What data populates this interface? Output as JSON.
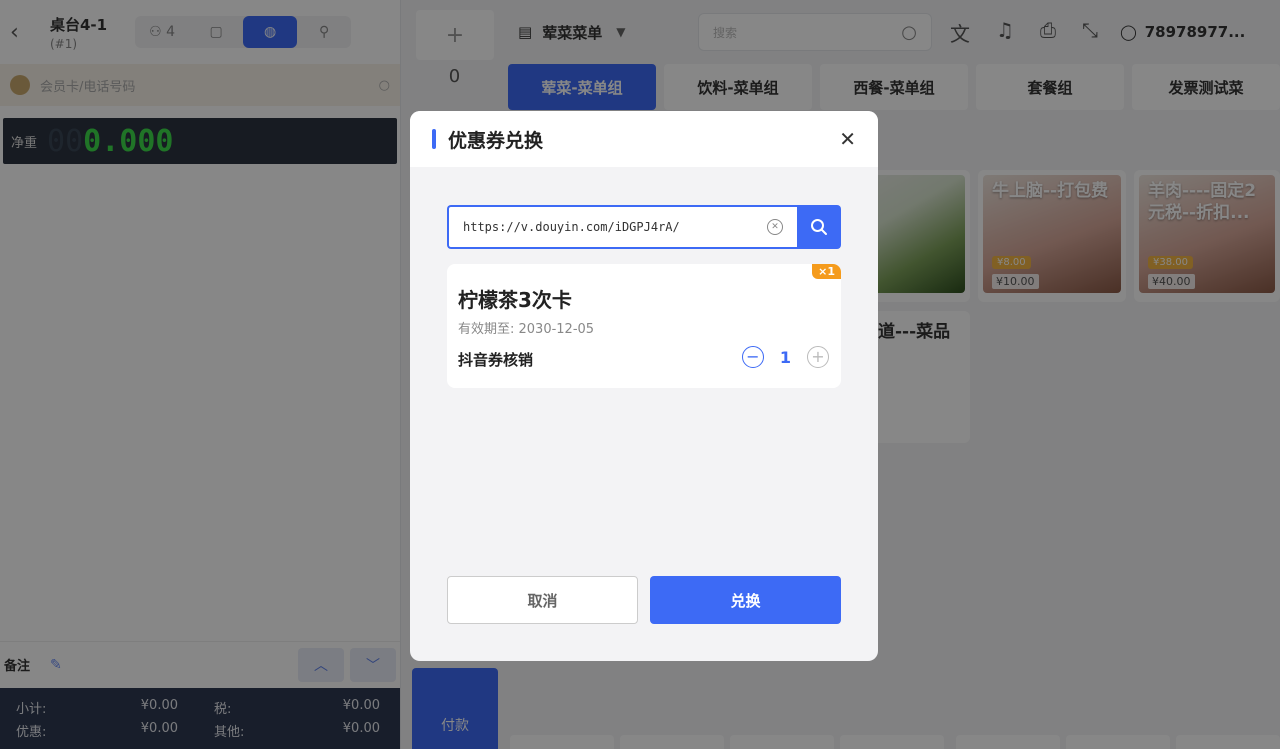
{
  "left": {
    "table_name": "桌台4-1",
    "table_sub": "(#1)",
    "guests": "4",
    "member_placeholder": "会员卡/电话号码",
    "weight_label": "净重",
    "weight_dim": "00",
    "weight_value": "0.000",
    "note_label": "备注",
    "totals": [
      {
        "label": "小计:",
        "value": "¥0.00"
      },
      {
        "label": "税:",
        "value": "¥0.00"
      },
      {
        "label": "优惠:",
        "value": "¥0.00"
      },
      {
        "label": "其他:",
        "value": "¥0.00"
      }
    ]
  },
  "mid": {
    "plus": "+",
    "count": "0",
    "pay_label": "付款"
  },
  "topbar": {
    "menu_name": "荤菜菜单",
    "search_placeholder": "搜索",
    "user": "78978977..."
  },
  "categories": [
    "荤菜-菜单组",
    "饮料-菜单组",
    "西餐-菜单组",
    "套餐组",
    "发票测试菜"
  ],
  "products": [
    {
      "name": "",
      "badge": "",
      "price": ""
    },
    {
      "name": "牛上脑--打包费",
      "badge": "¥8.00",
      "price": "¥10.00"
    },
    {
      "name": "羊肉----固定2元税--折扣...",
      "badge": "¥38.00",
      "price": "¥40.00"
    },
    {
      "name": "道---菜品",
      "badge": "",
      "price": ""
    }
  ],
  "modal": {
    "title": "优惠券兑换",
    "code_value": "https://v.douyin.com/iDGPJ4rA/",
    "coupon": {
      "name": "柠檬茶3次卡",
      "valid": "有效期至: 2030-12-05",
      "type": "抖音券核销",
      "qty": "1",
      "tag": "×1"
    },
    "cancel_label": "取消",
    "confirm_label": "兑换"
  },
  "colors": {
    "accent": "#3d6af5",
    "tag": "#f59b1c",
    "weight_digits": "#3ddc4a"
  }
}
